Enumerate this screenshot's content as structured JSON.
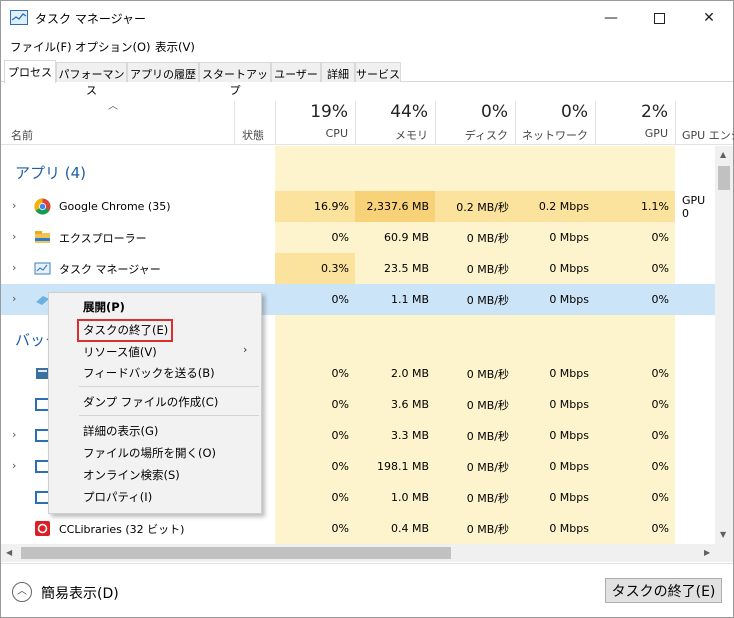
{
  "window": {
    "title": "タスク マネージャー"
  },
  "menu": [
    "ファイル(F)",
    "オプション(O)",
    "表示(V)"
  ],
  "tabs": [
    "プロセス",
    "パフォーマンス",
    "アプリの履歴",
    "スタートアップ",
    "ユーザー",
    "詳細",
    "サービス"
  ],
  "columns": {
    "name": "名前",
    "status": "状態",
    "cpu": {
      "pct": "19%",
      "label": "CPU"
    },
    "memory": {
      "pct": "44%",
      "label": "メモリ"
    },
    "disk": {
      "pct": "0%",
      "label": "ディスク"
    },
    "network": {
      "pct": "0%",
      "label": "ネットワーク"
    },
    "gpu": {
      "pct": "2%",
      "label": "GPU"
    },
    "gpu_engine": {
      "label": "GPU エンジ"
    }
  },
  "groups": {
    "apps": "アプリ (4)",
    "background_partial": "バック"
  },
  "rows": [
    {
      "name": "Google Chrome (35)",
      "cpu": "16.9%",
      "mem": "2,337.6 MB",
      "disk": "0.2 MB/秒",
      "net": "0.2 Mbps",
      "gpu": "1.1%",
      "gpu_engine": "GPU 0"
    },
    {
      "name": "エクスプローラー",
      "cpu": "0%",
      "mem": "60.9 MB",
      "disk": "0 MB/秒",
      "net": "0 Mbps",
      "gpu": "0%"
    },
    {
      "name": "タスク マネージャー",
      "cpu": "0.3%",
      "mem": "23.5 MB",
      "disk": "0 MB/秒",
      "net": "0 Mbps",
      "gpu": "0%"
    },
    {
      "name": "",
      "cpu": "0%",
      "mem": "1.1 MB",
      "disk": "0 MB/秒",
      "net": "0 Mbps",
      "gpu": "0%"
    },
    {
      "name": "",
      "cpu": "0%",
      "mem": "2.0 MB",
      "disk": "0 MB/秒",
      "net": "0 Mbps",
      "gpu": "0%"
    },
    {
      "name": "",
      "cpu": "0%",
      "mem": "3.6 MB",
      "disk": "0 MB/秒",
      "net": "0 Mbps",
      "gpu": "0%"
    },
    {
      "name": "",
      "cpu": "0%",
      "mem": "3.3 MB",
      "disk": "0 MB/秒",
      "net": "0 Mbps",
      "gpu": "0%"
    },
    {
      "name": "",
      "cpu": "0%",
      "mem": "198.1 MB",
      "disk": "0 MB/秒",
      "net": "0 Mbps",
      "gpu": "0%"
    },
    {
      "name": "",
      "cpu": "0%",
      "mem": "1.0 MB",
      "disk": "0 MB/秒",
      "net": "0 Mbps",
      "gpu": "0%"
    },
    {
      "name": "CCLibraries (32 ビット)",
      "cpu": "0%",
      "mem": "0.4 MB",
      "disk": "0 MB/秒",
      "net": "0 Mbps",
      "gpu": "0%"
    }
  ],
  "context_menu": {
    "expand": "展開(P)",
    "end_task": "タスクの終了(E)",
    "resource_values": "リソース値(V)",
    "feedback": "フィードバックを送る(B)",
    "dump": "ダンプ ファイルの作成(C)",
    "details": "詳細の表示(G)",
    "open_location": "ファイルの場所を開く(O)",
    "online_search": "オンライン検索(S)",
    "properties": "プロパティ(I)"
  },
  "footer": {
    "simple_view": "簡易表示(D)",
    "end_task_button": "タスクの終了(E)"
  }
}
